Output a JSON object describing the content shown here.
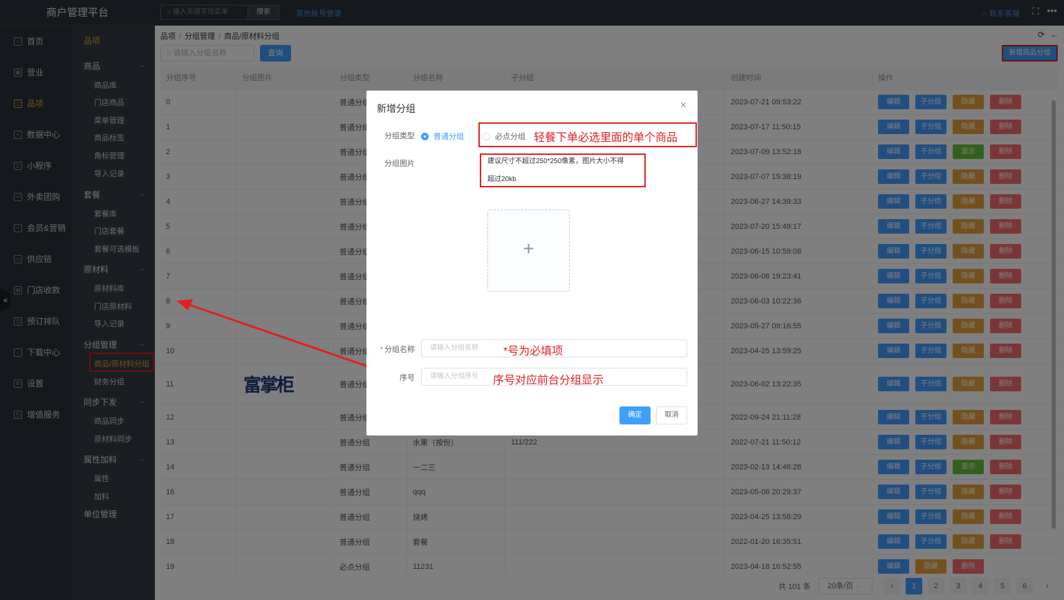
{
  "app": {
    "title": "商户管理平台"
  },
  "topbar": {
    "search_placeholder": "输入关键字找菜单",
    "search_btn": "搜索",
    "other_login": "其他账号登录",
    "contact": "联系客服",
    "contact_icon": "headset-icon",
    "fullscreen_icon": "fullscreen-icon",
    "more_icon": "more-icon"
  },
  "nav1": [
    {
      "label": "首页",
      "icon": "home-icon"
    },
    {
      "label": "营业",
      "icon": "calendar-icon"
    },
    {
      "label": "品项",
      "icon": "bag-icon",
      "active": true
    },
    {
      "label": "数据中心",
      "icon": "share-icon"
    },
    {
      "label": "小程序",
      "icon": "phone-icon"
    },
    {
      "label": "外卖团购",
      "icon": "bike-icon"
    },
    {
      "label": "会员&营销",
      "icon": "user-icon"
    },
    {
      "label": "供应链",
      "icon": "truck-icon"
    },
    {
      "label": "门店收款",
      "icon": "wallet-icon"
    },
    {
      "label": "预订排队",
      "icon": "clock-icon"
    },
    {
      "label": "下载中心",
      "icon": "download-icon"
    },
    {
      "label": "设置",
      "icon": "gear-icon"
    },
    {
      "label": "增值服务",
      "icon": "alarm-icon"
    }
  ],
  "nav2": {
    "title": "品项",
    "groups": [
      {
        "label": "商品",
        "items": [
          "商品库",
          "门店商品",
          "菜单管理",
          "商品标签",
          "角标管理",
          "导入记录"
        ]
      },
      {
        "label": "套餐",
        "items": [
          "套餐库",
          "门店套餐",
          "套餐可选模板"
        ]
      },
      {
        "label": "原材料",
        "items": [
          "原材料库",
          "门店原材料",
          "导入记录"
        ]
      },
      {
        "label": "分组管理",
        "items": [
          "商品/原材料分组",
          "财务分组"
        ]
      },
      {
        "label": "同步下发",
        "items": [
          "商品同步",
          "原材料同步"
        ]
      },
      {
        "label": "属性加料",
        "items": [
          "属性",
          "加料"
        ]
      },
      {
        "label": "单位管理",
        "items": []
      }
    ]
  },
  "breadcrumb": [
    "品项",
    "分组管理",
    "商品/原材料分组"
  ],
  "toolbar": {
    "search_placeholder": "请输入分组名称",
    "query": "查询",
    "add": "新增商品分组"
  },
  "table": {
    "headers": [
      "分组序号",
      "分组图片",
      "分组类型",
      "分组名称",
      "子分组",
      "创建时间",
      "操作"
    ],
    "rows": [
      {
        "seq": "0",
        "type": "普通分组",
        "name": "",
        "sub": "",
        "time": "2023-07-21 09:53:22",
        "vis": "隐藏"
      },
      {
        "seq": "1",
        "type": "普通分组",
        "name": "",
        "sub": "",
        "time": "2023-07-17 11:50:15",
        "vis": "隐藏"
      },
      {
        "seq": "2",
        "type": "普通分组",
        "name": "",
        "sub": "",
        "time": "2023-07-09 13:52:18",
        "vis": "显示"
      },
      {
        "seq": "3",
        "type": "普通分组",
        "name": "",
        "sub": "",
        "time": "2023-07-07 15:38:19",
        "vis": "隐藏"
      },
      {
        "seq": "4",
        "type": "普通分组",
        "name": "",
        "sub": "",
        "time": "2023-06-27 14:39:33",
        "vis": "隐藏"
      },
      {
        "seq": "5",
        "type": "普通分组",
        "name": "",
        "sub": "",
        "time": "2023-07-20 15:49:17",
        "vis": "隐藏"
      },
      {
        "seq": "6",
        "type": "普通分组",
        "name": "",
        "sub": "",
        "time": "2023-06-15 10:59:08",
        "vis": "隐藏"
      },
      {
        "seq": "7",
        "type": "普通分组",
        "name": "",
        "sub": "",
        "time": "2023-06-08 19:23:41",
        "vis": "隐藏"
      },
      {
        "seq": "8",
        "type": "普通分组",
        "name": "",
        "sub": "",
        "time": "2023-06-03 10:22:36",
        "vis": "隐藏"
      },
      {
        "seq": "9",
        "type": "普通分组",
        "name": "",
        "sub": "",
        "time": "2023-05-27 09:16:55",
        "vis": "隐藏"
      },
      {
        "seq": "10",
        "type": "普通分组",
        "name": "",
        "sub": "",
        "time": "2023-04-25 13:59:25",
        "vis": "隐藏"
      },
      {
        "seq": "11",
        "type": "普通分组",
        "name": "",
        "sub": "",
        "time": "2023-06-02 13:22:35",
        "vis": "隐藏",
        "img": "富掌柜"
      },
      {
        "seq": "12",
        "type": "普通分组",
        "name": "",
        "sub": "",
        "time": "2022-09-24 21:11:28",
        "vis": "隐藏"
      },
      {
        "seq": "13",
        "type": "普通分组",
        "name": "水果（按份）",
        "sub": "111/222",
        "time": "2022-07-21 11:50:12",
        "vis": "隐藏"
      },
      {
        "seq": "14",
        "type": "普通分组",
        "name": "一二三",
        "sub": "",
        "time": "2023-02-13 14:46:28",
        "vis": "显示"
      },
      {
        "seq": "16",
        "type": "普通分组",
        "name": "qqq",
        "sub": "",
        "time": "2023-05-06 20:29:37",
        "vis": "隐藏"
      },
      {
        "seq": "17",
        "type": "普通分组",
        "name": "烧烤",
        "sub": "",
        "time": "2023-04-25 13:58:29",
        "vis": "隐藏"
      },
      {
        "seq": "18",
        "type": "普通分组",
        "name": "套餐",
        "sub": "",
        "time": "2022-01-20 16:35:51",
        "vis": "隐藏"
      },
      {
        "seq": "19",
        "type": "必点分组",
        "name": "11231",
        "sub": "",
        "time": "2023-04-18 16:52:55",
        "vis": "隐藏",
        "partial": true
      }
    ],
    "ops": {
      "edit": "编辑",
      "sub": "子分组",
      "delete": "删除"
    }
  },
  "pager": {
    "total": "共 101 条",
    "size": "20条/页",
    "pages": [
      "1",
      "2",
      "3",
      "4",
      "5",
      "6"
    ],
    "current": "1"
  },
  "modal": {
    "title": "新增分组",
    "type_label": "分组类型",
    "type_options": [
      "普通分组",
      "必点分组"
    ],
    "image_label": "分组图片",
    "image_tip_line1": "建议尺寸不超过250*250像素，图片大小不得",
    "image_tip_line2": "超过20kb",
    "name_label": "分组名称",
    "name_placeholder": "请输入分组名称",
    "seq_label": "序号",
    "seq_placeholder": "请输入分组序号",
    "ok": "确定",
    "cancel": "取消"
  },
  "annotations": {
    "a1": "轻餐下单必选里面的单个商品",
    "a2": "*号为必填项",
    "a3": "序号对应前台分组显示"
  },
  "colors": {
    "primary": "#409eff",
    "warning": "#e6a23c",
    "success": "#67c23a",
    "danger": "#f56c6c",
    "annotation": "#e02020"
  }
}
